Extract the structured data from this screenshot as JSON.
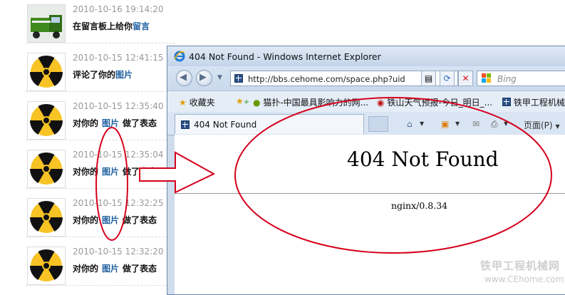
{
  "feed": {
    "items": [
      {
        "time": "2010-10-16 19:14:20",
        "text": "在留言板上给你",
        "link": "留言",
        "suffix": ""
      },
      {
        "time": "2010-10-15 12:41:15",
        "text": "评论了你的",
        "link": "图片",
        "suffix": ""
      },
      {
        "time": "2010-10-15 12:35:40",
        "text": "对你的",
        "link": "图片",
        "suffix": "做了表态"
      },
      {
        "time": "2010-10-15 12:35:04",
        "text": "对你的",
        "link": "图片",
        "suffix": "做了表态"
      },
      {
        "time": "2010-10-15 12:32:25",
        "text": "对你的",
        "link": "图片",
        "suffix": "做了表态"
      },
      {
        "time": "2010-10-15 12:32:20",
        "text": "对你的",
        "link": "图片",
        "suffix": "做了表态"
      }
    ]
  },
  "browser": {
    "title": "404 Not Found - Windows Internet Explorer",
    "address": "http://bbs.cehome.com/space.php?uid",
    "search_placeholder": "Bing",
    "favorites_label": "收藏夹",
    "favorites": [
      "猫扑-中国最具影响力的网...",
      "铁山天气预报-今日_明日_...",
      "铁甲工程机械"
    ],
    "tab_label": "404 Not Found",
    "page_menu": "页面(P)",
    "page": {
      "heading": "404 Not Found",
      "server": "nginx/0.8.34"
    }
  },
  "watermark": {
    "line1": "铁甲工程机械网",
    "line2": "www.CEhome.com"
  },
  "colors": {
    "annotation": "#d6001c",
    "link": "#2060a0"
  }
}
